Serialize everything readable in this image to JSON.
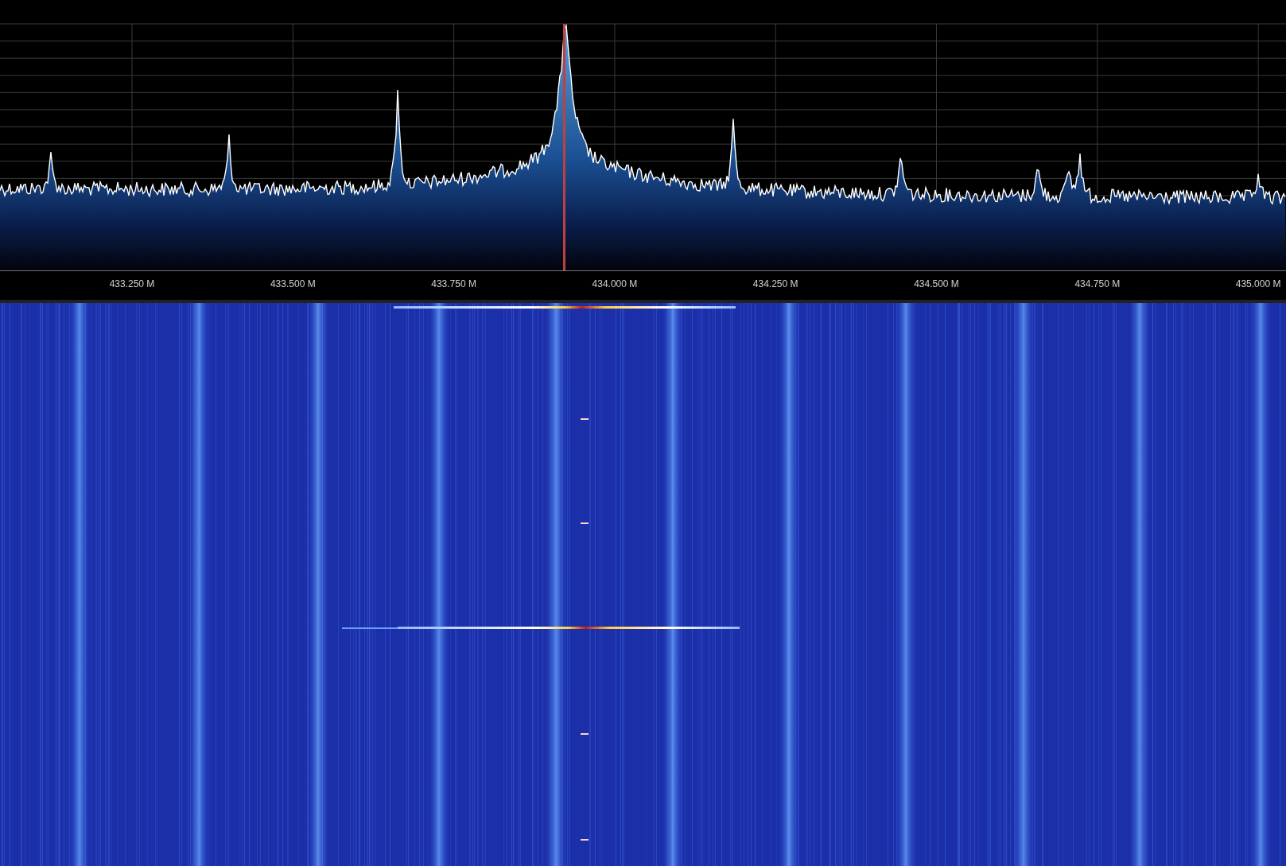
{
  "spectrum": {
    "axis_labels": [
      "433.250 M",
      "433.500 M",
      "433.750 M",
      "434.000 M",
      "434.250 M",
      "434.500 M",
      "434.750 M",
      "435.000 M"
    ]
  }
}
